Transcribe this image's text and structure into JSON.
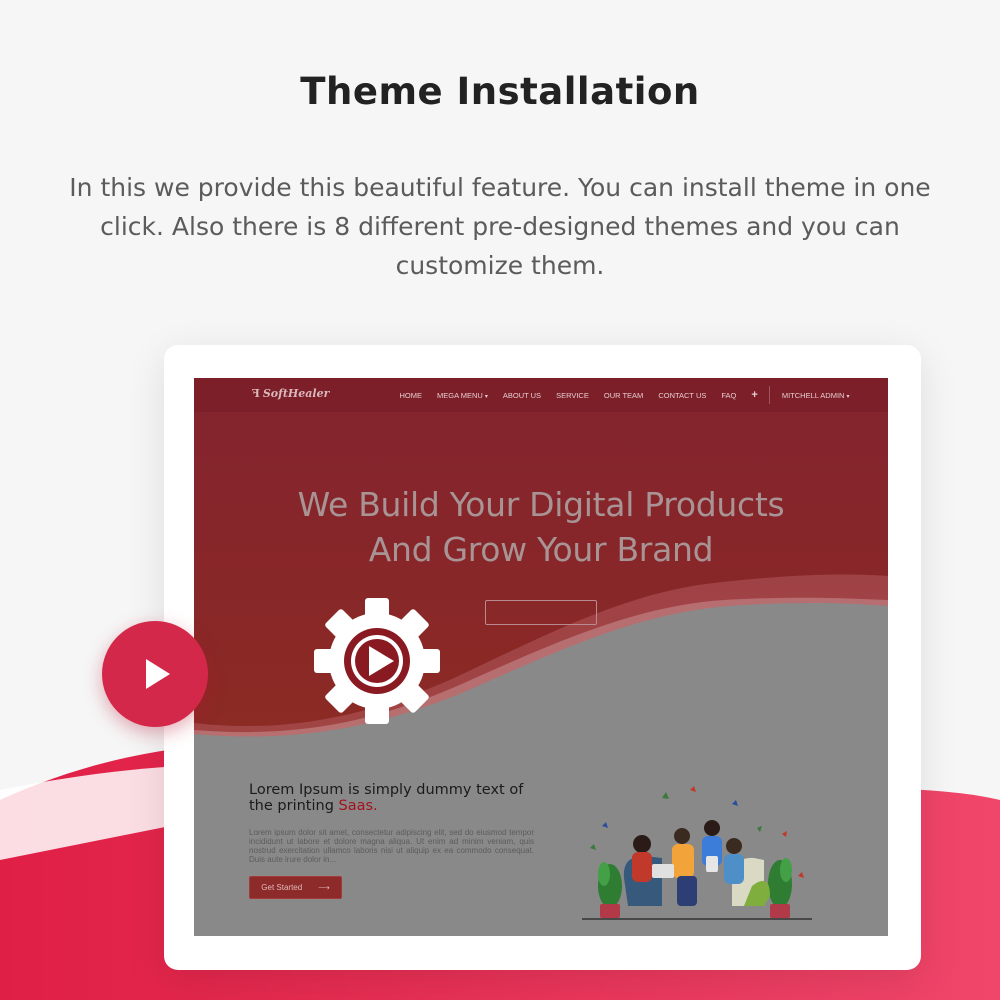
{
  "page": {
    "title": "Theme Installation",
    "subtitle": "In this we provide this beautiful feature. You can install theme in one click. Also there is 8 different pre-designed themes and you can customize them."
  },
  "preview": {
    "logo": "SoftHealer",
    "nav": [
      {
        "label": "HOME",
        "dropdown": false
      },
      {
        "label": "MEGA MENU",
        "dropdown": true
      },
      {
        "label": "ABOUT US",
        "dropdown": false
      },
      {
        "label": "SERVICE",
        "dropdown": false
      },
      {
        "label": "OUR TEAM",
        "dropdown": false
      },
      {
        "label": "CONTACT US",
        "dropdown": false
      },
      {
        "label": "FAQ",
        "dropdown": false
      },
      {
        "label": "+",
        "dropdown": false
      },
      {
        "label": "MITCHELL ADMIN",
        "dropdown": true
      }
    ],
    "hero": {
      "line1": "We Build Your Digital Products",
      "line2": "And Grow Your Brand"
    },
    "content": {
      "heading_main": "Lorem Ipsum is simply dummy text of the printing ",
      "heading_accent": "Saas.",
      "body": "Lorem ipsum dolor sit amet, consectetur adipiscing elit, sed do eiusmod tempor incididunt ut labore et dolore magna aliqua. Ut enim ad minim veniam, quis nostrud exercitation ullamco laboris nisi ut aliquip ex ea commodo consequat. Duis aute irure dolor in...",
      "cta": "Get Started",
      "cta_arrow": "⟶"
    }
  },
  "icons": {
    "play_button": "play-icon",
    "video_cog": "gear-play-icon"
  },
  "colors": {
    "brand_red": "#d3284a",
    "hero_red": "#8f2a2e",
    "accent": "#a3121e"
  }
}
